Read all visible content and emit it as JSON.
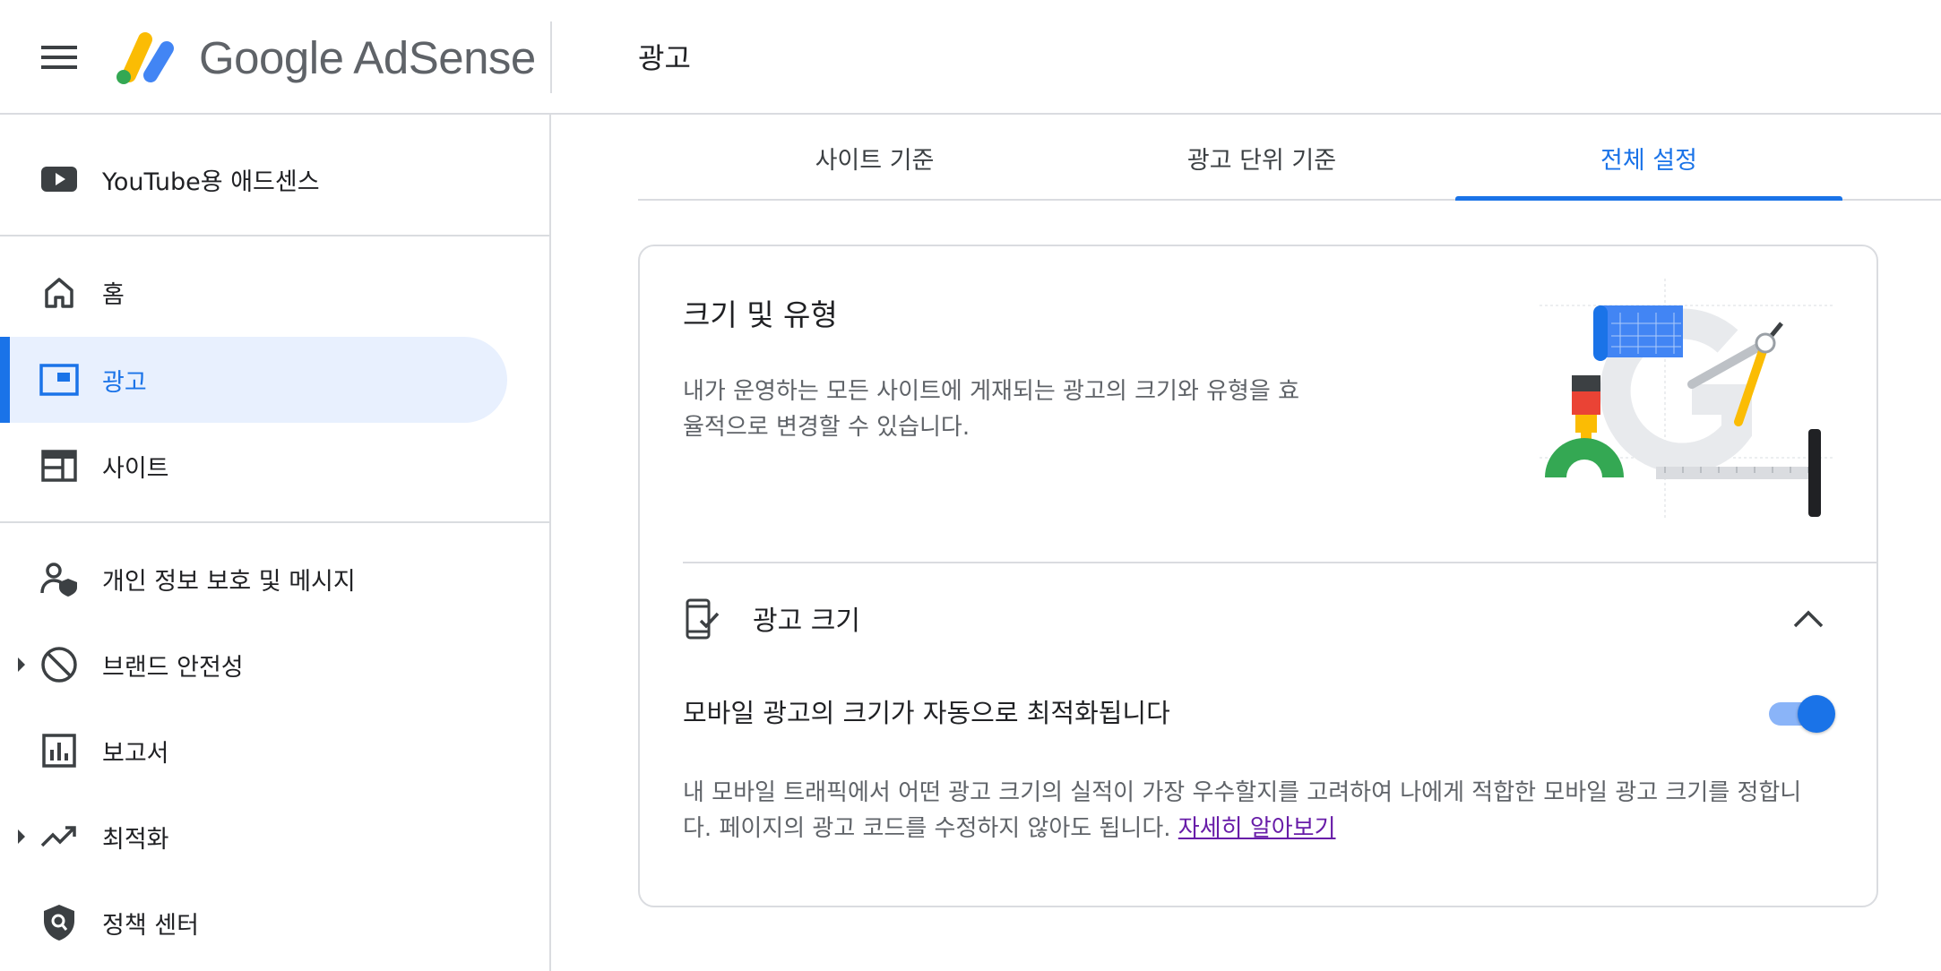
{
  "header": {
    "menu_icon": "menu-icon",
    "logo_icon": "adsense-logo-icon",
    "logo_text": "Google AdSense",
    "title": "광고"
  },
  "sidebar": {
    "items": [
      {
        "label": "YouTube용 애드센스",
        "icon": "youtube-icon"
      },
      {
        "label": "홈",
        "icon": "home-icon"
      },
      {
        "label": "광고",
        "icon": "ads-icon",
        "active": true
      },
      {
        "label": "사이트",
        "icon": "sites-icon"
      },
      {
        "label": "개인 정보 보호 및 메시지",
        "icon": "privacy-messaging-icon"
      },
      {
        "label": "브랜드 안전성",
        "icon": "block-icon",
        "expandable": true
      },
      {
        "label": "보고서",
        "icon": "reports-icon"
      },
      {
        "label": "최적화",
        "icon": "trending-up-icon",
        "expandable": true
      },
      {
        "label": "정책 센터",
        "icon": "policy-shield-icon"
      }
    ]
  },
  "tabs": [
    {
      "label": "사이트 기준"
    },
    {
      "label": "광고 단위 기준"
    },
    {
      "label": "전체 설정",
      "active": true
    }
  ],
  "card": {
    "title": "크기 및 유형",
    "description_line1": "내가 운영하는 모든 사이트에 게재되는 광고의 크기와 유형을 효",
    "description_line2": "율적으로 변경할 수 있습니다.",
    "illustration": "design-tools-illustration",
    "section": {
      "icon": "mobile-check-icon",
      "title": "광고 크기",
      "collapse_icon": "chevron-up-icon",
      "setting_label": "모바일 광고의 크기가 자동으로 최적화됩니다",
      "toggle_on": true,
      "setting_desc_line1": "내 모바일 트래픽에서 어떤 광고 크기의 실적이 가장 우수할지를 고려하여 나에게 적합한 모바일 광고 크기를 정합니",
      "setting_desc_line2": "다. 페이지의 광고 코드를 수정하지 않아도 됩니다. ",
      "learn_more": "자세히 알아보기"
    }
  },
  "colors": {
    "accent": "#1a73e8",
    "active_bg": "#e8f0fe",
    "link_visited": "#681da8",
    "divider": "#dadce0"
  }
}
